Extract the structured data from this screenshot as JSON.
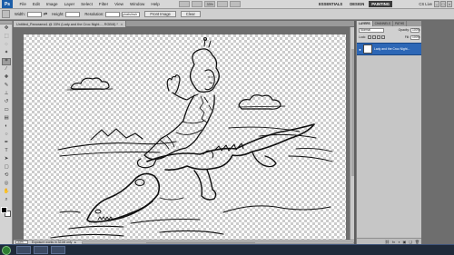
{
  "app": {
    "logo": "Ps",
    "menus": [
      "File",
      "Edit",
      "Image",
      "Layer",
      "Select",
      "Filter",
      "View",
      "Window",
      "Help"
    ],
    "zoom_box": "33%",
    "workspaces": [
      "ESSENTIALS",
      "DESIGN",
      "PAINTING"
    ],
    "active_workspace": "PAINTING",
    "cs_live": "CS Live",
    "window_controls": [
      "–",
      "□",
      "×"
    ]
  },
  "options_bar": {
    "width_label": "Width:",
    "height_label": "Height:",
    "resolution_label": "Resolution:",
    "resolution_unit": "pixels/inch",
    "front_image_button": "Front Image",
    "clear_button": "Clear"
  },
  "tools": [
    {
      "icon": "move-icon",
      "glyph": "✥"
    },
    {
      "icon": "marquee-icon",
      "glyph": "⬚"
    },
    {
      "icon": "lasso-icon",
      "glyph": "◌"
    },
    {
      "icon": "magic-wand-icon",
      "glyph": "✦"
    },
    {
      "icon": "crop-icon",
      "glyph": "⌗",
      "active": true
    },
    {
      "icon": "eyedropper-icon",
      "glyph": "⁄"
    },
    {
      "icon": "healing-icon",
      "glyph": "✚"
    },
    {
      "icon": "brush-icon",
      "glyph": "✎"
    },
    {
      "icon": "stamp-icon",
      "glyph": "⊥"
    },
    {
      "icon": "history-brush-icon",
      "glyph": "↺"
    },
    {
      "icon": "eraser-icon",
      "glyph": "▭"
    },
    {
      "icon": "gradient-icon",
      "glyph": "▤"
    },
    {
      "icon": "blur-icon",
      "glyph": "◐"
    },
    {
      "icon": "dodge-icon",
      "glyph": "○"
    },
    {
      "icon": "pen-icon",
      "glyph": "✒"
    },
    {
      "icon": "type-icon",
      "glyph": "T"
    },
    {
      "icon": "path-select-icon",
      "glyph": "➤"
    },
    {
      "icon": "shape-icon",
      "glyph": "▢"
    },
    {
      "icon": "3d-rotate-icon",
      "glyph": "⟲"
    },
    {
      "icon": "3d-orbit-icon",
      "glyph": "◎"
    },
    {
      "icon": "hand-icon",
      "glyph": "✋"
    },
    {
      "icon": "zoom-icon",
      "glyph": "⌕"
    }
  ],
  "document": {
    "tab_title": "Untitled_Panorama1 @ 33% (Lady and the Croc Night..., RGB/8) *",
    "tab_close": "×",
    "zoom": "33%",
    "status_info": "Exposure works in 32-bit only",
    "status_arrow": "▸"
  },
  "layers_panel": {
    "tabs": [
      "LAYERS",
      "CHANNELS",
      "PATHS"
    ],
    "active_tab": "LAYERS",
    "blend_mode": "Normal",
    "opacity_label": "Opacity:",
    "opacity_value": "100%",
    "lock_label": "Lock:",
    "fill_label": "Fill:",
    "fill_value": "100%",
    "layer_name": "Lady and the Croc Night...",
    "layer_visible_glyph": "●",
    "footer_icons": [
      "⛓",
      "fx",
      "◑",
      "▣",
      "❏",
      "🗑"
    ]
  },
  "taskbar": {
    "tray_time": ""
  }
}
